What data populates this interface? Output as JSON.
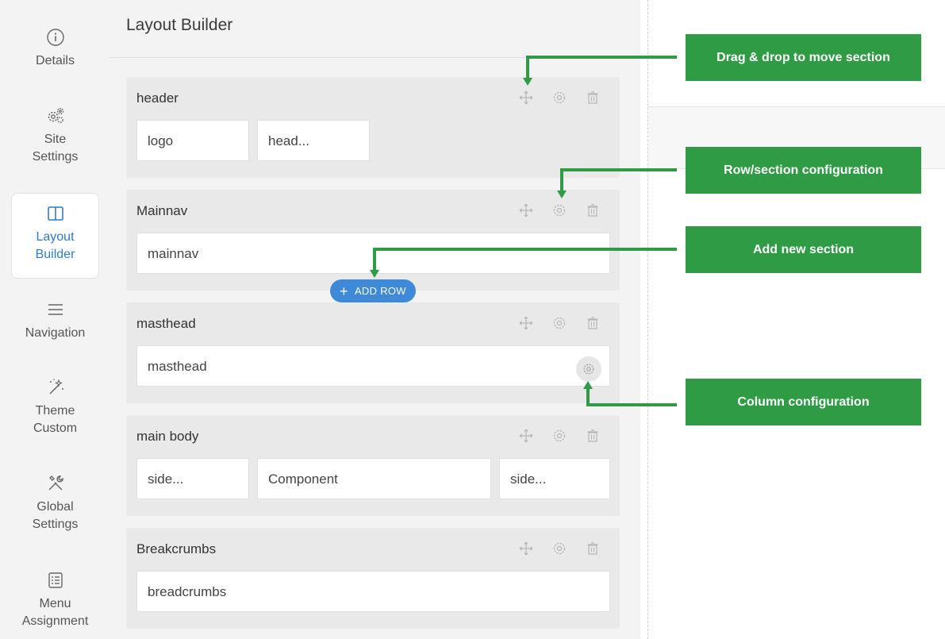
{
  "sidebar": {
    "items": [
      {
        "label": "Details",
        "icon": "info-icon",
        "active": false
      },
      {
        "label": "Site\nSettings",
        "icon": "gears-icon",
        "active": false
      },
      {
        "label": "Layout\nBuilder",
        "icon": "layout-icon",
        "active": true
      },
      {
        "label": "Navigation",
        "icon": "hamburger-icon",
        "active": false
      },
      {
        "label": "Theme\nCustom",
        "icon": "magic-wand-icon",
        "active": false
      },
      {
        "label": "Global\nSettings",
        "icon": "tools-icon",
        "active": false
      },
      {
        "label": "Menu\nAssignment",
        "icon": "list-icon",
        "active": false
      }
    ]
  },
  "main": {
    "title": "Layout Builder",
    "add_row_label": "ADD ROW",
    "sections": [
      {
        "name": "header",
        "columns": [
          "logo",
          "head..."
        ]
      },
      {
        "name": "Mainnav",
        "columns": [
          "mainnav"
        ]
      },
      {
        "name": "masthead",
        "columns": [
          "masthead"
        ]
      },
      {
        "name": "main body",
        "columns": [
          "side...",
          "Component",
          "side..."
        ]
      },
      {
        "name": "Breakcrumbs",
        "columns": [
          "breadcrumbs"
        ]
      }
    ],
    "tool_icons": [
      "move-icon",
      "gear-icon",
      "trash-icon"
    ]
  },
  "callouts": {
    "drag": "Drag & drop to move section",
    "row_config": "Row/section configuration",
    "add_section": "Add new section",
    "column_config": "Column configuration"
  },
  "colors": {
    "accent_blue": "#2f7bc6",
    "add_row_blue": "#3f8ad8",
    "callout_green": "#2f9c45"
  }
}
